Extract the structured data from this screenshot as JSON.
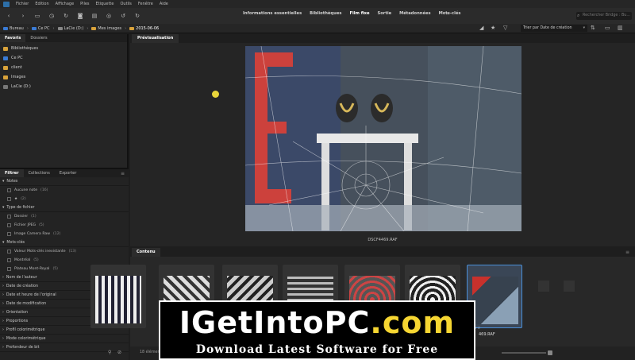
{
  "menu": {
    "items": [
      "Fichier",
      "Edition",
      "Affichage",
      "Piles",
      "Etiquette",
      "Outils",
      "Fenêtre",
      "Aide"
    ]
  },
  "workspaces": {
    "items": [
      "Informations essentielles",
      "Bibliothèques",
      "Film fixe",
      "Sortie",
      "Métadonnées",
      "Mots-clés"
    ],
    "active": "Film fixe"
  },
  "search": {
    "placeholder": "Rechercher Bridge : Bu..."
  },
  "path": {
    "items": [
      "Bureau",
      "Ce PC",
      "LaCie (D:)",
      "Mes images",
      "2015-06-06"
    ]
  },
  "sort": {
    "label": "Trier par Date de création"
  },
  "left": {
    "tabs": [
      "Favoris",
      "Dossiers"
    ],
    "favorites": [
      {
        "label": "Bibliothèques",
        "color": "#d9a23a"
      },
      {
        "label": "Ce PC",
        "color": "#3a7bd5"
      },
      {
        "label": "client",
        "color": "#d9a23a"
      },
      {
        "label": "Images",
        "color": "#d9a23a"
      },
      {
        "label": "LaCie (D:)",
        "color": "#777777"
      }
    ]
  },
  "filter": {
    "tabs": [
      "Filtrer",
      "Collections",
      "Exporter"
    ],
    "sections": [
      {
        "label": "Notes",
        "items": [
          {
            "label": "Aucune note",
            "count": "(16)"
          },
          {
            "label": "★",
            "count": "(2)"
          }
        ]
      },
      {
        "label": "Type de fichier",
        "items": [
          {
            "label": "Dossier",
            "count": "(1)"
          },
          {
            "label": "Fichier JPEG",
            "count": "(5)"
          },
          {
            "label": "Image Camera Raw",
            "count": "(12)"
          }
        ]
      },
      {
        "label": "Mots-clés",
        "items": [
          {
            "label": "Valeur Mots-clés inexistante",
            "count": "(13)"
          },
          {
            "label": "Montréal",
            "count": "(5)"
          },
          {
            "label": "Plateau Mont-Royal",
            "count": "(5)"
          }
        ]
      }
    ],
    "collapsed": [
      "Nom de l'auteur",
      "Date de création",
      "Date et heure de l'original",
      "Date de modification",
      "Orientation",
      "Proportions",
      "Profil colorimétrique",
      "Mode colorimétrique",
      "Profondeur de bit"
    ]
  },
  "preview": {
    "tab": "Prévisualisation",
    "caption": "DSCF4469.RAF"
  },
  "content": {
    "tab": "Contenu",
    "selected_label": "469.RAF",
    "status": "18 éléments"
  },
  "watermark": {
    "title_main": "IGetIntoPC",
    "title_suffix": ".com",
    "subtitle": "Download Latest Software for Free"
  }
}
